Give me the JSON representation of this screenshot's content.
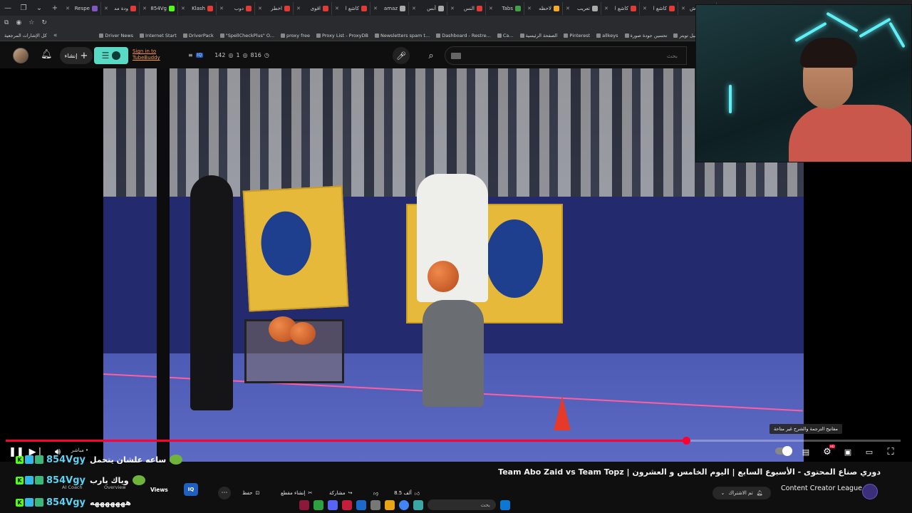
{
  "browser": {
    "tabs": [
      {
        "label": "Respe",
        "color": "#7e57c2"
      },
      {
        "label": "ودة مد",
        "color": "#e53935"
      },
      {
        "label": "854Vg",
        "color": "#53fc18"
      },
      {
        "label": "Klash",
        "color": "#e53935"
      },
      {
        "label": "دوب",
        "color": "#e53935"
      },
      {
        "label": "اخطر",
        "color": "#e53935"
      },
      {
        "label": "اقوى",
        "color": "#e53935"
      },
      {
        "label": "كاشع ا",
        "color": "#e53935"
      },
      {
        "label": "amaz",
        "color": "#aaaaaa"
      },
      {
        "label": "أنس",
        "color": "#aaaaaa"
      },
      {
        "label": "النس",
        "color": "#e53935"
      },
      {
        "label": "Tabs",
        "color": "#43a047"
      },
      {
        "label": "لاحظه",
        "color": "#f9a825"
      },
      {
        "label": "تعريب",
        "color": "#aaaaaa"
      },
      {
        "label": "كاشع ا",
        "color": "#e53935"
      },
      {
        "label": "كاشع ا",
        "color": "#e53935"
      },
      {
        "label": "فاك ش",
        "color": "#e53935"
      }
    ],
    "bookmarks": [
      "كل الإشارات المرجعية",
      "Driver News",
      "Internet Start",
      "DriverPack",
      "\"SpellCheckPlus\" O...",
      "proxy free",
      "Proxy List - ProxyDB",
      "Newsletters spam t...",
      "Dashboard - Restre...",
      "Ca...",
      "الصفحة الرئيسية",
      "Pinterest",
      "allkeys",
      "تحسين جودة صورة",
      "تحميل تويتر"
    ]
  },
  "header": {
    "create_label": "إنشاء",
    "tubebuddy_sign_in": "Sign in to",
    "tubebuddy_name": "TubeBuddy",
    "stats": {
      "likes": "142",
      "dislikes": "1",
      "views": "816"
    },
    "search_placeholder": "بحث"
  },
  "player": {
    "live_label": "مباشر",
    "tooltip": "مفاتيح الترجمة والشرح غير متاحة",
    "progress": 0.76
  },
  "video": {
    "title": "دوري صناع المحتوى - الأسبوع السابع | اليوم الخامس و العشرون | Team Abo Zaid vs Team Topz",
    "channel": "Content Creator League",
    "subscribe_label": "تم الاشتراك",
    "actions": {
      "likes": "8.5 ألف",
      "share": "مشاركة",
      "clip": "إنشاء مقطع",
      "save": "حفظ"
    }
  },
  "tubebuddy_tabs": {
    "coach": "AI Coach",
    "overview": "Overview",
    "views": "Views",
    "iq": "IQ"
  },
  "chat": [
    {
      "user": "854Vgy",
      "message": "ساعه علشان يتحمل"
    },
    {
      "user": "854Vgy",
      "message": "وياك يارب"
    },
    {
      "user": "854Vgy",
      "message": "هههههههه"
    }
  ],
  "taskbar": {
    "search_placeholder": "بحث"
  }
}
